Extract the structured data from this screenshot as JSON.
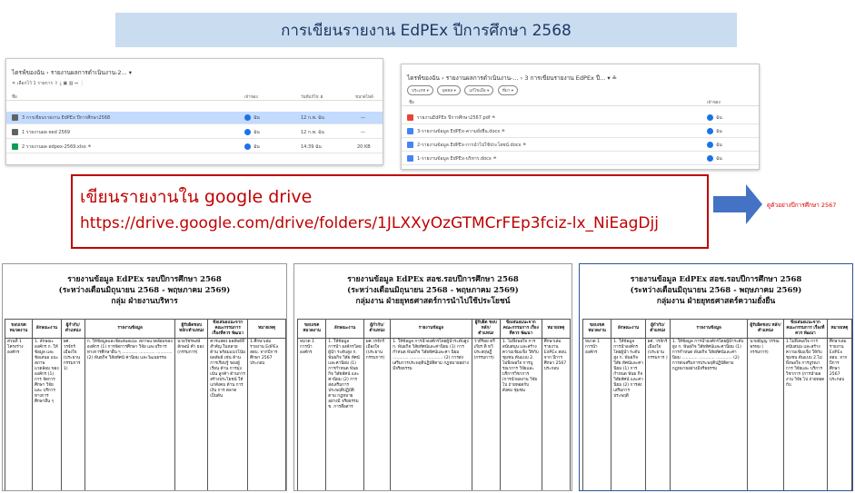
{
  "title": "การเขียนรายงาน EdPEx ปีการศึกษา 2568",
  "drive_left": {
    "breadcrumb": "ไดรฟ์ของฉัน › รายงานผลการดำเนินงาน-2... ▾",
    "toolbar": "✕  เลือกไว้ 1 รายการ   ⇪  ⤓  ▣  ▥  ⇔  ⋮",
    "columns": {
      "name": "ชื่อ",
      "owner": "เจ้าของ",
      "modified": "วันที่แก้ไข ⬇",
      "size": "ขนาดไฟล์"
    },
    "rows": [
      {
        "name": "3 การเขียนรายงาน EdPEx ปีการศึกษา2568",
        "owner": "ฉัน",
        "modified": "12 ก.พ. ฉัน",
        "size": "—",
        "selected": true,
        "icon": "folder-icon"
      },
      {
        "name": "1 รายงานผล eed 2569",
        "owner": "ฉัน",
        "modified": "12 ก.พ. ฉัน",
        "size": "—",
        "selected": false,
        "icon": "folder-icon"
      },
      {
        "name": "2 รายงานผล edpex-2569.xlsx ≗",
        "owner": "ฉัน",
        "modified": "14:39 ฉัน",
        "size": "20 KB",
        "selected": false,
        "icon": "sheet-icon"
      }
    ]
  },
  "drive_right": {
    "breadcrumb": "ไดรฟ์ของฉัน › รายงานผลการดำเนินงาน-... › 3 การเขียนรายงาน EdPEx ปี... ▾ ≗",
    "chips": [
      "ประเภท ▾",
      "บุคคล ▾",
      "แก้ไขเมื่อ ▾",
      "ที่มา ▾"
    ],
    "columns": {
      "name": "ชื่อ",
      "owner": "เจ้าของ"
    },
    "rows": [
      {
        "name": "รายงานEdPEx ปีการศึกษา2567.pdf ≗",
        "owner": "ฉัน",
        "icon": "pdf-icon"
      },
      {
        "name": "3-รายงานข้อมูล EdPEx-ความยั่งยืน.docx ≗",
        "owner": "ฉัน",
        "icon": "doc-icon"
      },
      {
        "name": "2-รายงานข้อมูล EdPEx-การนำไปใช้ประโยชน์.docx ≗",
        "owner": "ฉัน",
        "icon": "doc-icon"
      },
      {
        "name": "1-รายงานข้อมูล EdPEx-บริหาร.docx ≗",
        "owner": "ฉัน",
        "icon": "doc-icon"
      }
    ]
  },
  "note": {
    "line1": "เขียนรายงานใน google drive",
    "line2": "https://drive.google.com/drive/folders/1JLXXyOzGTMCrFEp3fciz-lx_NiEagDjj"
  },
  "arrow_label": "ดูตัวอย่างปีการศึกษา 2567",
  "docs": [
    {
      "title1": "รายงานข้อมูล EdPEx รอบปีการศึกษา 2568",
      "title2": "(ระหว่างเดือนมิถุนายน 2568 - พฤษภาคม 2569)",
      "title3": "กลุ่ม ฝ่ายงานบริหาร",
      "headers": [
        "ขอบเขต หมวดงาน",
        "ลักษณะงาน",
        "ผู้กำกับ/ ตำแหน่ง",
        "รายงานข้อมูล",
        "ผู้รับผิดชอบ หลัก/ตำแหน่ง",
        "ข้อเสนอแนะจาก คณะกรรมการ เรื่องที่ควร พัฒนา",
        "หมายเหตุ"
      ],
      "col1": "ส่วนที่ 1 โครงร่าง องค์กร",
      "col2": "1. ลักษณะ องค์กร ก. ให้ข้อมูล และข้อเสนอ แนะ สภาพ แวดล้อม ขององค์กร (1) การ จัดการศึกษา วิจัย และ บริการ ทางการ ศึกษาอื่น ๆ",
      "col3": "ผศ. วรจักร์ เมืองใจ (ประธาน กรรมการ 1)",
      "col4": "ก. ให้ข้อมูลและข้อเสนอแนะ สภาพแวดล้อมขององค์กร (1) การจัดการศึกษา วิจัย และบริการทางการศึกษาอื่น ๆ ............ ............ ............ (2) พันธกิจ วิสัยทัศน์ ค่านิยม และวัฒนธรรม",
      "col5": "นายวัชรพงษ์ ลักษณ์ คำ ยอง (กรรมการ)",
      "col6": "ควรแสดง ผลลัพธ์ที่สำคัญ ในหลายด้าน พร้อมแนวโน้ม ผลลัพธ์ เช่น ด้านการเรียนรู้ ของผู้เรียน ด้าน การมุ่งเน้น ลูกค้า ด้านการ สร้างประโยชน์ ให้แก่สังคม ด้าน การเงิน การ ตลาด เป็นต้น",
      "col7": "1.ศึกษาเล่ม รายงาน EdPEx สอบ. จากปีการ ศึกษา 2567 ประกอบ"
    },
    {
      "title1": "รายงานข้อมูล EdPEx สอช.รอบปีการศึกษา 2568",
      "title2": "(ระหว่างเดือนมิถุนายน 2568 - พฤษภาคม 2569)",
      "title3": "กลุ่มงาน ฝ่ายยุทธศาสตร์การนำไปใช้ประโยชน์",
      "headers": [
        "ขอบเขต หมวดงาน",
        "ลักษณะงาน",
        "ผู้กำกับ/ ตำแหน่ง",
        "รายงานข้อมูล",
        "ผู้รับผิด ชอบหลัก/ ตำแหน่ง",
        "ข้อเสนอแนะจาก คณะกรรมการ เรื่องที่ควร พัฒนา",
        "หมายเหตุ"
      ],
      "col1": "หมวด 1 การนำ องค์กร",
      "col2": "1. ให้ข้อมูล การนำ องค์กรโดยผู้นำ ระดับสูง ก. พันธกิจ วิสัย ทัศน์และค่านิยม (1) การกำหนด พันธกิจ วิสัยทัศน์ และค่านิยม (2) การส่งเสริมการ ประพฤติปฏิบัติตาม กฎหมายอย่างมี จริยธรรม ข. การสื่อสาร",
      "col3": "ผศ.วรจักร์ เมืองใจ (ประธาน กรรมการ)",
      "col4": "1. ให้ข้อมูล การนำองค์กรโดยผู้นำระดับสูง ก. พันธกิจ วิสัยทัศน์และค่านิยม (1) การกำหนด พันธกิจ วิสัยทัศน์และค่า นิยม ............ ............ ............ (2) การส่งเสริมการประพฤติปฏิบัติตาม กฎหมายอย่างมีจริยธรรม",
      "col5": "ว่าที่ร้อย ตรีเกียร ติ ทวี ประสฤษฎิ์ (กรรมการ)",
      "col6": "1. ไม่พึงพอใจ การสนับสนุน และสร้าง ความเข้มแข็ง ให้กับชุมชน ต้นแบบ 2. ไม่พึงพอใจ การบูรณาการ วิจัยและ บริการวิชาการ (การนำผลงาน วิจัย ไป ถ่ายทอดกับ สังคม ชุมชน",
      "col7": "ศึกษาเล่ม รายงาน EdPEx สอบ. จาก ปีการ ศึกษา 2567 ประกอบ"
    },
    {
      "title1": "รายงานข้อมูล EdPEx สอช.รอบปีการศึกษา 2568",
      "title2": "(ระหว่างเดือนมิถุนายน 2568 - พฤษภาคม 2569)",
      "title3": "กลุ่มงาน ฝ่ายยุทธศาสตร์ความยั่งยืน",
      "headers": [
        "ขอบเขต หมวดงาน",
        "ลักษณะงาน",
        "ผู้กำกับ/ ตำแหน่ง",
        "รายงานข้อมูล",
        "ผู้รับผิดชอบ หลัก/ตำแหน่ง",
        "ข้อเสนอแนะจาก คณะกรรมการ เรื่องที่ควร พัฒนา",
        "หมายเหตุ"
      ],
      "col1": "หมวด 1 การนำ องค์กร",
      "col2": "1. ให้ข้อมูล การนำองค์กร โดยผู้นำ ระดับสูง ก. พันธกิจ วิสัย ทัศน์และค่านิยม (1) การ กำหนด พันธ กิจ วิสัยทัศน์ และค่านิยม (2) การส่ง เสริมการ ประพฤติ",
      "col3": "ผศ. วรจักร์ เมืองใจ (ประธาน กรรมการ )",
      "col4": "1. ให้ข้อมูล การนำองค์กรโดยผู้นำระดับสูง ก. พันธกิจ วิสัยทัศน์และค่านิยม (1) การกำหนด พันธกิจ วิสัยทัศน์และค่า นิยม ............ ............ ............ (2) การส่งเสริมการประพฤติปฏิบัติตาม กฎหมายอย่างมีจริยธรรม",
      "col5": "นายธัญญ วรรณพรหม ( กรรมการ)",
      "col6": "1.ไม่พึงพอใจ การสนับสนุน และสร้าง ความเข้มแข็ง ให้กับชุมชน ต้นแบบ 2.ไม่พึงพอใจ การบูรณาการ วิจัยและ บริการวิชาการ (การนำผลงาน วิจัย ไป ถ่ายทอดกับ",
      "col7": "ศึกษาเล่ม รายงาน EdPEx สอบ. จากปีการ ศึกษา 2567 ประกอบ"
    }
  ],
  "colors": {
    "accent": "#1a73e8",
    "note_red": "#c00000",
    "title_bg": "#c9dcf0",
    "arrow": "#4472c4"
  }
}
